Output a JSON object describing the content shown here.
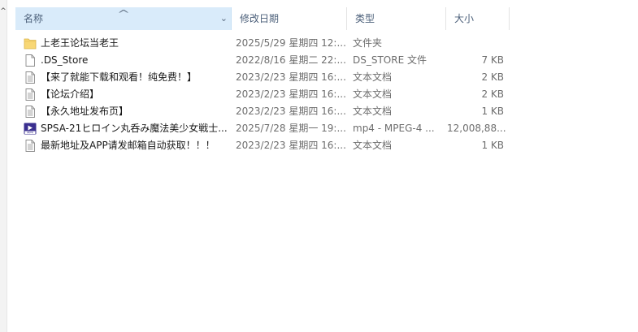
{
  "columns": {
    "name": "名称",
    "date_modified": "修改日期",
    "type": "类型",
    "size": "大小"
  },
  "files": [
    {
      "icon": "folder-icon",
      "name": "上老王论坛当老王",
      "date": "2025/5/29 星期四 12:...",
      "type": "文件夹",
      "size": ""
    },
    {
      "icon": "file-icon",
      "name": ".DS_Store",
      "date": "2022/8/16 星期二 22:...",
      "type": "DS_STORE 文件",
      "size": "7 KB"
    },
    {
      "icon": "text-file-icon",
      "name": "【来了就能下载和观看！纯免费！】",
      "date": "2023/2/23 星期四 16:...",
      "type": "文本文档",
      "size": "2 KB"
    },
    {
      "icon": "text-file-icon",
      "name": "【论坛介绍】",
      "date": "2023/2/23 星期四 16:...",
      "type": "文本文档",
      "size": "2 KB"
    },
    {
      "icon": "text-file-icon",
      "name": "【永久地址发布页】",
      "date": "2023/2/23 星期四 16:...",
      "type": "文本文档",
      "size": "1 KB"
    },
    {
      "icon": "video-file-icon",
      "name": "SPSA-21ヒロイン丸呑み魔法美少女戦士...",
      "date": "2025/7/28 星期一 19:...",
      "type": "mp4 - MPEG-4 ...",
      "size": "12,008,88..."
    },
    {
      "icon": "text-file-icon",
      "name": "最新地址及APP请发邮箱自动获取！！！",
      "date": "2023/2/23 星期四 16:...",
      "type": "文本文档",
      "size": "1 KB"
    }
  ]
}
